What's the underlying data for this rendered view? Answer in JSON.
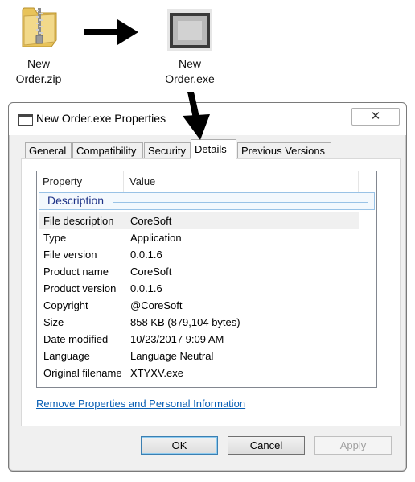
{
  "desktop": {
    "zip_label": "New\nOrder.zip",
    "exe_label": "New\nOrder.exe"
  },
  "dialog": {
    "title": "New Order.exe Properties",
    "close_label": "✕",
    "tabs": [
      {
        "label": "General",
        "active": false
      },
      {
        "label": "Compatibility",
        "active": false
      },
      {
        "label": "Security",
        "active": false
      },
      {
        "label": "Details",
        "active": true
      },
      {
        "label": "Previous Versions",
        "active": false
      }
    ],
    "columns": {
      "property": "Property",
      "value": "Value"
    },
    "group": "Description",
    "rows": [
      {
        "property": "File description",
        "value": "CoreSoft"
      },
      {
        "property": "Type",
        "value": "Application"
      },
      {
        "property": "File version",
        "value": "0.0.1.6"
      },
      {
        "property": "Product name",
        "value": "CoreSoft"
      },
      {
        "property": "Product version",
        "value": "0.0.1.6"
      },
      {
        "property": "Copyright",
        "value": "@CoreSoft"
      },
      {
        "property": "Size",
        "value": "858 KB (879,104 bytes)"
      },
      {
        "property": "Date modified",
        "value": "10/23/2017 9:09 AM"
      },
      {
        "property": "Language",
        "value": "Language Neutral"
      },
      {
        "property": "Original filename",
        "value": "XTYXV.exe"
      }
    ],
    "link": "Remove Properties and Personal Information",
    "buttons": {
      "ok": "OK",
      "cancel": "Cancel",
      "apply": "Apply"
    }
  },
  "colors": {
    "link": "#0a5fb4",
    "group_header_text": "#1e3287",
    "group_border": "#99c2e6"
  }
}
